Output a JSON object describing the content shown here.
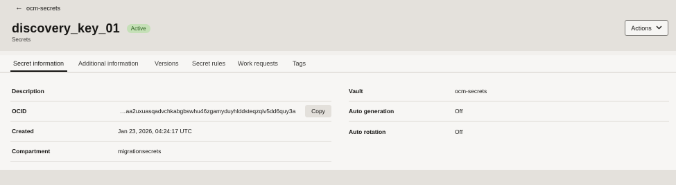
{
  "header": {
    "back_label": "ocm-secrets",
    "title": "discovery_key_01",
    "status": "Active",
    "subtitle": "Secrets",
    "actions_label": "Actions"
  },
  "tabs": [
    {
      "label": "Secret information",
      "active": true
    },
    {
      "label": "Additional information",
      "active": false
    },
    {
      "label": "Versions",
      "active": false
    },
    {
      "label": "Secret rules",
      "active": false
    },
    {
      "label": "Work requests",
      "active": false
    },
    {
      "label": "Tags",
      "active": false
    }
  ],
  "details_left": {
    "description_label": "Description",
    "description_value": "",
    "ocid_label": "OCID",
    "ocid_value": "…aa2uxuasqadvchkabgbswhu46zgamyduyhlddsteqzqiv5dd6quy3a",
    "copy_label": "Copy",
    "created_label": "Created",
    "created_value": "Jan 23, 2026, 04:24:17 UTC",
    "compartment_label": "Compartment",
    "compartment_value": "migrationsecrets"
  },
  "details_right": {
    "vault_label": "Vault",
    "vault_value": "ocm-secrets",
    "auto_generation_label": "Auto generation",
    "auto_generation_value": "Off",
    "auto_rotation_label": "Auto rotation",
    "auto_rotation_value": "Off"
  },
  "colors": {
    "badge_bg": "#c5e0b7",
    "banner_green": "#3f6b4a",
    "banner_yellow": "#e0b84a"
  }
}
